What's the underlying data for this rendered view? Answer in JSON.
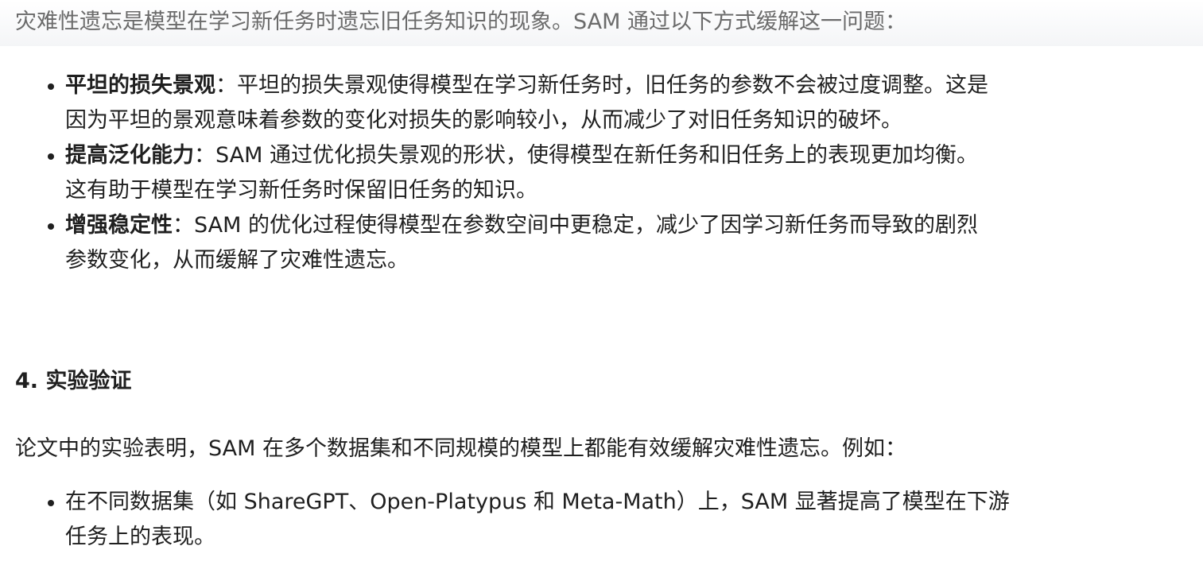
{
  "intro": "灾难性遗忘是模型在学习新任务时遗忘旧任务知识的现象。SAM 通过以下方式缓解这一问题：",
  "bullets_main": [
    {
      "term": "平坦的损失景观",
      "sep": "：",
      "line1": "平坦的损失景观使得模型在学习新任务时，旧任务的参数不会被过度调整。这是",
      "line2": "因为平坦的景观意味着参数的变化对损失的影响较小，从而减少了对旧任务知识的破坏。"
    },
    {
      "term": "提高泛化能力",
      "sep": "：",
      "line1": "SAM 通过优化损失景观的形状，使得模型在新任务和旧任务上的表现更加均衡。",
      "line2": "这有助于模型在学习新任务时保留旧任务的知识。"
    },
    {
      "term": "增强稳定性",
      "sep": "：",
      "line1": "SAM 的优化过程使得模型在参数空间中更稳定，减少了因学习新任务而导致的剧烈",
      "line2": "参数变化，从而缓解了灾难性遗忘。"
    }
  ],
  "section_heading": "4. 实验验证",
  "paragraph": "论文中的实验表明，SAM 在多个数据集和不同规模的模型上都能有效缓解灾难性遗忘。例如：",
  "bullets_results": [
    {
      "line1": "在不同数据集（如 ShareGPT、Open-Platypus 和 Meta-Math）上，SAM 显著提高了模型在下游",
      "line2": "任务上的表现。"
    }
  ]
}
